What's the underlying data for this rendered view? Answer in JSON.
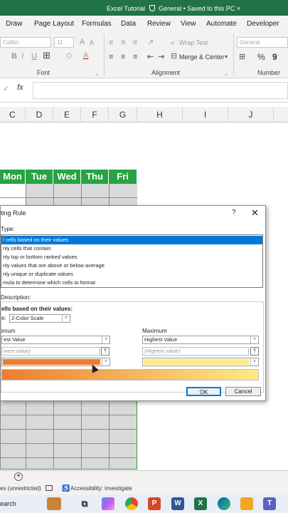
{
  "window": {
    "title": "Excel Tutorial",
    "save_status": "General • Saved to this PC",
    "chevron": "˅"
  },
  "tabs": [
    "Draw",
    "Page Layout",
    "Formulas",
    "Data",
    "Review",
    "View",
    "Automate",
    "Developer"
  ],
  "ribbon": {
    "font_name": "Calibri",
    "font_size": "11",
    "wrap_text": "Wrap Text",
    "merge_center": "Merge & Center",
    "number_format": "General",
    "percent": "%",
    "comma": "9",
    "groups": {
      "font": "Font",
      "alignment": "Alignment",
      "number": "Number"
    }
  },
  "formula_bar": {
    "cancel": "✓",
    "fx": "fx"
  },
  "columns": [
    "C",
    "D",
    "E",
    "F",
    "G",
    "H",
    "I",
    "J"
  ],
  "days": [
    "Mon",
    "Tue",
    "Wed",
    "Thu",
    "Fri"
  ],
  "dialog": {
    "title": "ting Rule",
    "help": "?",
    "close": "✕",
    "type_label": "Type:",
    "rule_types": [
      "l cells based on their values",
      "nly cells that contain",
      "nly top or bottom ranked values",
      "nly values that are above or below average",
      "nly unique or duplicate values",
      "mula to determine which cells to format"
    ],
    "description_label": " Description:",
    "format_label": "ells based on their values:",
    "style_label": "e:",
    "style_value": "2-Color Scale",
    "minimum": {
      "label": "imum",
      "type_value": "est Value",
      "value_placeholder": "west value)",
      "color": "#ed7d31"
    },
    "maximum": {
      "label": "Maximum",
      "type_value": "Highest Value",
      "value_placeholder": "(Highest value)",
      "color": "#ffeb84"
    },
    "ok": "OK",
    "cancel": "Cancel"
  },
  "sheet_bar": {
    "add": "+"
  },
  "status_bar": {
    "left": "es (unrestricted)",
    "accessibility": "Accessibility: Investigate"
  },
  "taskbar": {
    "search": "earch"
  }
}
